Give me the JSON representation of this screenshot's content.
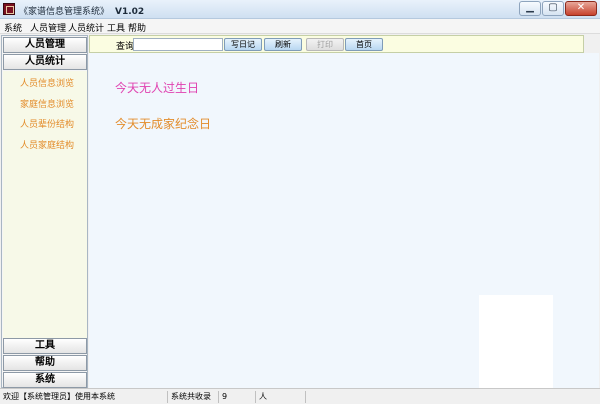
{
  "window": {
    "title": "《家谱信息管理系统》",
    "version": "V1.02",
    "min_label": "▁",
    "max_label": "▢",
    "close_label": "✕"
  },
  "menu": {
    "items": [
      "系统",
      "人员管理",
      "人员统计",
      "工具",
      "帮助"
    ]
  },
  "sidebar": {
    "headers": {
      "personnel": "人员管理",
      "stats": "人员统计",
      "tools": "工具",
      "help": "帮助",
      "system": "系统"
    },
    "links": [
      "人员信息浏览",
      "家庭信息浏览",
      "人员辈份结构",
      "人员家庭结构"
    ]
  },
  "toolbar": {
    "search_label": "查询",
    "search_value": "",
    "buttons": {
      "diary": "写日记",
      "refresh": "刷新",
      "print": "打印",
      "home": "首页"
    }
  },
  "content": {
    "birthday_notice": "今天无人过生日",
    "anniversary_notice": "今天无成家纪念日"
  },
  "status": {
    "welcome": "欢迎【系统管理员】使用本系统",
    "total_label": "系统共收录",
    "total_count": "9",
    "unit": "人"
  },
  "colors": {
    "birthday": "#e042b0",
    "anniversary": "#e38c2a",
    "link": "#e38c2a",
    "sidebar_bg": "#f7f9e8",
    "content_bg": "#f1f7fd"
  }
}
